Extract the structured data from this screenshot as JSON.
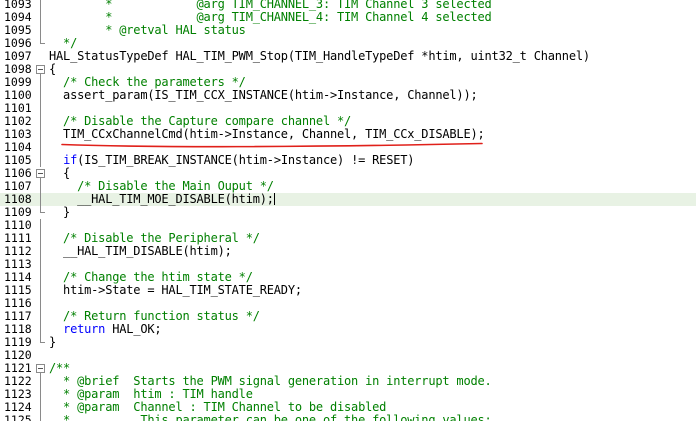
{
  "editor": {
    "current_line": "1108",
    "lines": [
      {
        "num": "1093",
        "fold": "line",
        "tokens": [
          {
            "t": "        *            @arg TIM_CHANNEL_3: TIM Channel 3 selected",
            "c": "comment"
          }
        ]
      },
      {
        "num": "1094",
        "fold": "line",
        "tokens": [
          {
            "t": "        *            @arg TIM_CHANNEL_4: TIM Channel 4 selected",
            "c": "comment"
          }
        ]
      },
      {
        "num": "1095",
        "fold": "line",
        "tokens": [
          {
            "t": "        * @retval HAL status",
            "c": "comment"
          }
        ]
      },
      {
        "num": "1096",
        "fold": "end",
        "tokens": [
          {
            "t": "  */",
            "c": "comment"
          }
        ]
      },
      {
        "num": "1097",
        "fold": "none",
        "tokens": [
          {
            "t": "HAL_StatusTypeDef HAL_TIM_PWM_Stop(TIM_HandleTypeDef *htim, uint32_t Channel)",
            "c": "plain"
          }
        ]
      },
      {
        "num": "1098",
        "fold": "box",
        "tokens": [
          {
            "t": "{",
            "c": "plain"
          }
        ]
      },
      {
        "num": "1099",
        "fold": "line",
        "tokens": [
          {
            "t": "  /* Check the parameters */",
            "c": "comment"
          }
        ]
      },
      {
        "num": "1100",
        "fold": "line",
        "tokens": [
          {
            "t": "  assert_param(IS_TIM_CCX_INSTANCE(htim->Instance, Channel));",
            "c": "plain"
          }
        ]
      },
      {
        "num": "1101",
        "fold": "line",
        "tokens": []
      },
      {
        "num": "1102",
        "fold": "line",
        "tokens": [
          {
            "t": "  /* Disable the Capture compare channel */",
            "c": "comment"
          }
        ]
      },
      {
        "num": "1103",
        "fold": "line",
        "tokens": [
          {
            "t": "  TIM_CCxChannelCmd(htim->Instance, Channel, TIM_CCx_DISABLE);",
            "c": "plain"
          }
        ]
      },
      {
        "num": "1104",
        "fold": "line",
        "tokens": []
      },
      {
        "num": "1105",
        "fold": "line",
        "tokens": [
          {
            "t": "  ",
            "c": "plain"
          },
          {
            "t": "if",
            "c": "keyword"
          },
          {
            "t": "(IS_TIM_BREAK_INSTANCE(htim->Instance) != RESET)",
            "c": "plain"
          }
        ]
      },
      {
        "num": "1106",
        "fold": "box",
        "tokens": [
          {
            "t": "  {",
            "c": "plain"
          }
        ]
      },
      {
        "num": "1107",
        "fold": "line",
        "tokens": [
          {
            "t": "    /* Disable the Main Ouput */",
            "c": "comment"
          }
        ]
      },
      {
        "num": "1108",
        "fold": "line",
        "tokens": [
          {
            "t": "    __HAL_TIM_MOE_DISABLE(htim);",
            "c": "plain"
          }
        ],
        "caret": true
      },
      {
        "num": "1109",
        "fold": "end",
        "tokens": [
          {
            "t": "  }",
            "c": "plain"
          }
        ]
      },
      {
        "num": "1110",
        "fold": "line",
        "tokens": []
      },
      {
        "num": "1111",
        "fold": "line",
        "tokens": [
          {
            "t": "  /* Disable the Peripheral */",
            "c": "comment"
          }
        ]
      },
      {
        "num": "1112",
        "fold": "line",
        "tokens": [
          {
            "t": "  __HAL_TIM_DISABLE(htim);",
            "c": "plain"
          }
        ]
      },
      {
        "num": "1113",
        "fold": "line",
        "tokens": []
      },
      {
        "num": "1114",
        "fold": "line",
        "tokens": [
          {
            "t": "  /* Change the htim state */",
            "c": "comment"
          }
        ]
      },
      {
        "num": "1115",
        "fold": "line",
        "tokens": [
          {
            "t": "  htim->State = HAL_TIM_STATE_READY;",
            "c": "plain"
          }
        ]
      },
      {
        "num": "1116",
        "fold": "line",
        "tokens": []
      },
      {
        "num": "1117",
        "fold": "line",
        "tokens": [
          {
            "t": "  /* Return function status */",
            "c": "comment"
          }
        ]
      },
      {
        "num": "1118",
        "fold": "line",
        "tokens": [
          {
            "t": "  ",
            "c": "plain"
          },
          {
            "t": "return",
            "c": "keyword"
          },
          {
            "t": " HAL_OK;",
            "c": "plain"
          }
        ]
      },
      {
        "num": "1119",
        "fold": "end",
        "tokens": [
          {
            "t": "}",
            "c": "plain"
          }
        ]
      },
      {
        "num": "1120",
        "fold": "none",
        "tokens": []
      },
      {
        "num": "1121",
        "fold": "box",
        "tokens": [
          {
            "t": "/**",
            "c": "comment"
          }
        ]
      },
      {
        "num": "1122",
        "fold": "line",
        "tokens": [
          {
            "t": "  * @brief  Starts the PWM signal generation in interrupt mode.",
            "c": "comment"
          }
        ]
      },
      {
        "num": "1123",
        "fold": "line",
        "tokens": [
          {
            "t": "  * @param  htim : TIM handle",
            "c": "comment"
          }
        ]
      },
      {
        "num": "1124",
        "fold": "line",
        "tokens": [
          {
            "t": "  * @param  Channel : TIM Channel to be disabled",
            "c": "comment"
          }
        ]
      },
      {
        "num": "1125",
        "fold": "line",
        "tokens": [
          {
            "t": "  *          This parameter can be one of the following values:",
            "c": "comment"
          }
        ]
      }
    ]
  },
  "colors": {
    "comment": "#008000",
    "keyword": "#0000ff",
    "plain": "#000000",
    "current_line_bg": "#e8f2e4",
    "annotation_underline": "#e0201a"
  }
}
